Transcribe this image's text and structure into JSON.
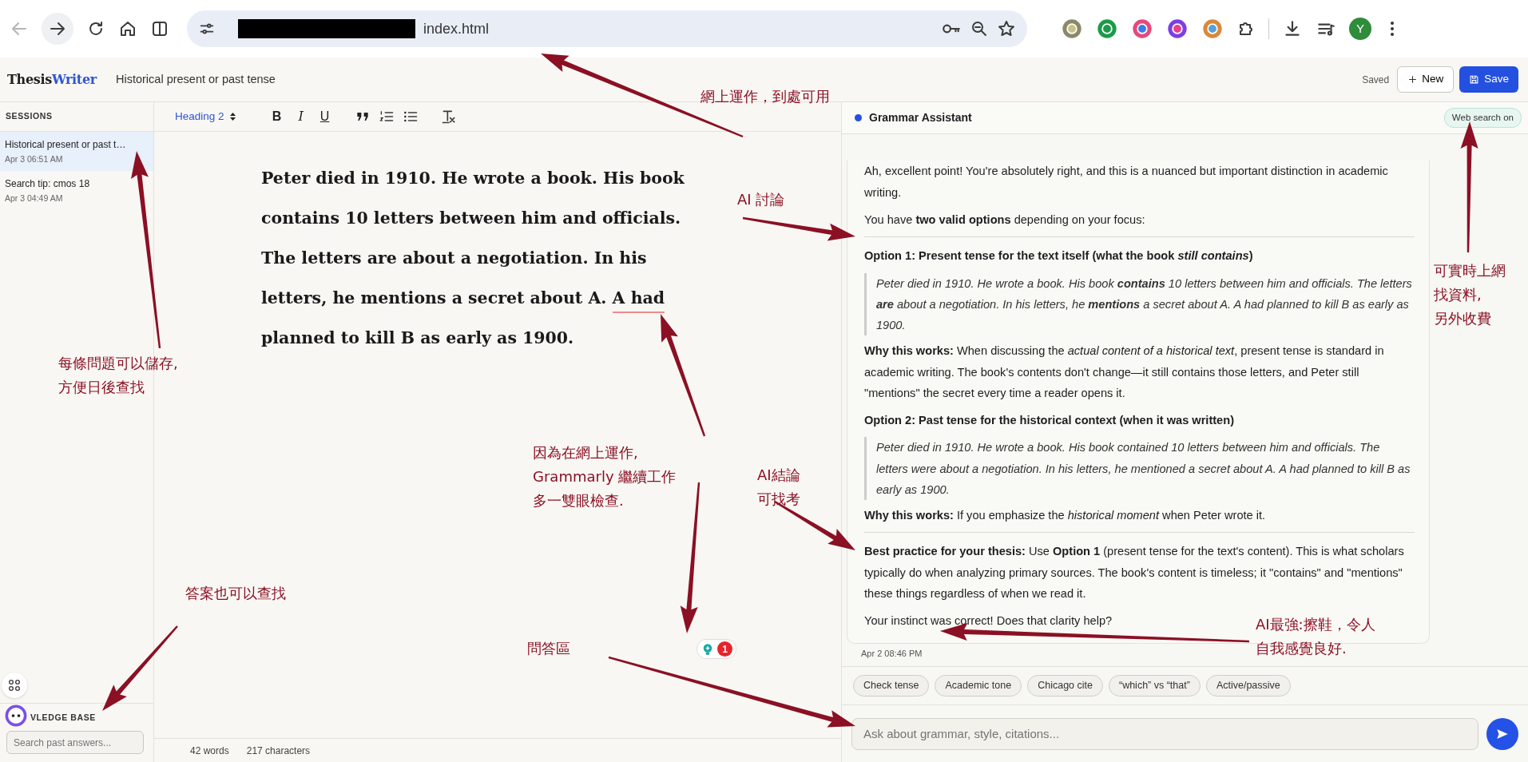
{
  "browser": {
    "url_text": "index.html",
    "profile_initial": "Y"
  },
  "app": {
    "logo_first": "Thesis",
    "logo_second": "Writer",
    "document_title": "Historical present or past tense",
    "save_status": "Saved",
    "buttons": [
      {
        "label": "New",
        "kind": "outline"
      },
      {
        "label": "Save",
        "kind": "primary"
      }
    ]
  },
  "sidebar": {
    "heading": "SESSIONS",
    "items": [
      {
        "title": "Historical present or past t…",
        "time": "Apr 3 06:51 AM",
        "selected": true
      },
      {
        "title": "Search tip: cmos 18",
        "time": "Apr 3 04:49 AM",
        "selected": false
      }
    ],
    "knowledge_base": {
      "heading": "VLEDGE BASE",
      "placeholder": "Search past answers..."
    }
  },
  "toolbar": {
    "block_style": "Heading 2",
    "buttons": [
      {
        "kind": "bold",
        "label": "B"
      },
      {
        "kind": "italic",
        "label": "I"
      },
      {
        "kind": "underline",
        "label": "U"
      },
      {
        "kind": "quote"
      },
      {
        "kind": "ordered-list"
      },
      {
        "kind": "bullet-list"
      },
      {
        "kind": "clear-format"
      }
    ]
  },
  "editor": {
    "parts": [
      {
        "text": "Peter died in 1910. He wrote a book. His book contains 10 letters between him and officials. The letters are about a negotiation. In his letters, he mentions a secret about A. ",
        "flagged": false
      },
      {
        "text": "A had",
        "flagged": true
      },
      {
        "text": " planned to kill B as early as 1900.",
        "flagged": false
      }
    ],
    "grammarly_count": "1",
    "word_count": "42 words",
    "char_count": "217 characters"
  },
  "chat": {
    "title": "Grammar Assistant",
    "web_search": {
      "label": "Web search on",
      "on": true
    },
    "blocks": [
      {
        "kind": "p",
        "text": "Ah, excellent point! You're absolutely right, and this is a nuanced but important distinction in academic writing."
      },
      {
        "kind": "p",
        "text": "You have **two valid options** depending on your focus:"
      },
      {
        "kind": "rule"
      },
      {
        "kind": "heading",
        "text": "Option 1: Present tense for the text itself (what the book *still contains*)"
      },
      {
        "kind": "quote",
        "text": "Peter died in 1910. He wrote a book. His book **contains** 10 letters between him and officials. The letters **are** about a negotiation. In his letters, he **mentions** a secret about A. A had planned to kill B as early as 1900."
      },
      {
        "kind": "p",
        "text": "**Why this works:** When discussing the *actual content of a historical text*, present tense is standard in academic writing. The book's contents don't change—it still contains those letters, and Peter still \"mentions\" the secret every time a reader opens it."
      },
      {
        "kind": "heading",
        "text": "Option 2: Past tense for the historical context (when it was written)"
      },
      {
        "kind": "quote",
        "text": "Peter died in 1910. He wrote a book. His book contained 10 letters between him and officials. The letters were about a negotiation. In his letters, he mentioned a secret about A. A had planned to kill B as early as 1900."
      },
      {
        "kind": "p",
        "text": "**Why this works:** If you emphasize the *historical moment* when Peter wrote it."
      },
      {
        "kind": "rule"
      },
      {
        "kind": "p",
        "text": "**Best practice for your thesis:** Use **Option 1** (present tense for the text's content). This is what scholars typically do when analyzing primary sources. The book's content is timeless; it \"contains\" and \"mentions\" these things regardless of when we read it."
      },
      {
        "kind": "p",
        "text": "Your instinct was correct! Does that clarity help?"
      }
    ],
    "time": "Apr 2 08:46 PM",
    "chips": [
      "Check tense",
      "Academic tone",
      "Chicago cite",
      "“which” vs “that”",
      "Active/passive"
    ],
    "placeholder": "Ask about grammar, style, citations..."
  },
  "annotations": [
    {
      "lines": [
        "網上運作，到處可用"
      ]
    },
    {
      "lines": [
        "AI 討論"
      ]
    },
    {
      "lines": [
        "可實時上網",
        "找資料,",
        "另外收費"
      ]
    },
    {
      "lines": [
        "每條問題可以儲存,",
        "方便日後查找"
      ]
    },
    {
      "lines": [
        "因為在網上運作,",
        "Grammarly 繼續工作",
        "多一雙眼檢查."
      ]
    },
    {
      "lines": [
        "AI結論",
        "可找考"
      ]
    },
    {
      "lines": [
        "答案也可以查找"
      ]
    },
    {
      "lines": [
        "問答區"
      ]
    },
    {
      "lines": [
        "AI最強:擦鞋，令人",
        "自我感覺良好."
      ]
    }
  ]
}
